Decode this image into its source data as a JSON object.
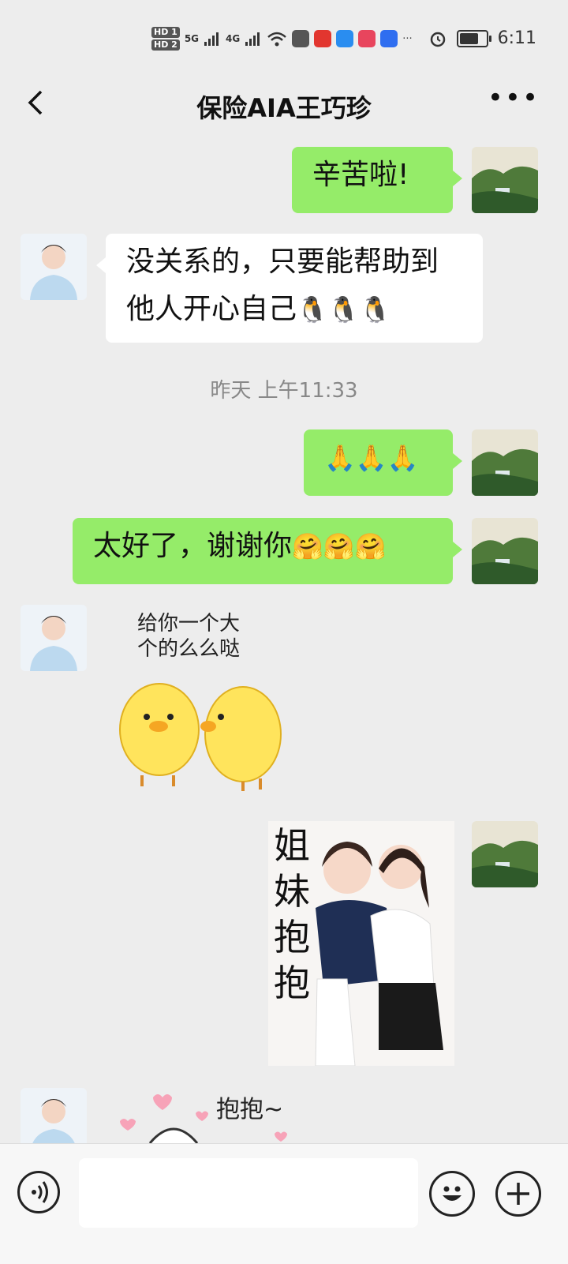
{
  "status_bar": {
    "hd1": "HD 1",
    "hd2": "HD 2",
    "net1": "5G",
    "net2": "4G",
    "more": "···",
    "time": "6:11",
    "battery_level": 0.75
  },
  "header": {
    "title": "保险AIA王巧珍"
  },
  "messages": [
    {
      "from": "me",
      "text": "辛苦啦!"
    },
    {
      "from": "contact",
      "line1": "没关系的，只要能帮助到",
      "line2": "他人开心自己",
      "emoji": "🐧🐧🐧"
    },
    {
      "from": "me",
      "emoji": "🙏🙏🙏"
    },
    {
      "from": "me",
      "text": "太好了，谢谢你",
      "emoji": "🤗🤗🤗"
    },
    {
      "from": "contact",
      "sticker_line1": "给你一个大",
      "sticker_line2": "个的么么哒"
    },
    {
      "from": "me",
      "photo_caption": [
        "姐",
        "妹",
        "抱",
        "抱"
      ]
    },
    {
      "from": "contact",
      "sticker_text": "抱抱~"
    }
  ],
  "timestamp": "昨天 上午11:33",
  "colors": {
    "background": "#ededed",
    "outgoing_bubble": "#95ec69",
    "incoming_bubble": "#ffffff"
  },
  "icons": {
    "back": "chevron-left-icon",
    "more": "more-dots-icon",
    "voice": "voice-icon",
    "emoji": "smiley-icon",
    "plus": "plus-icon"
  }
}
